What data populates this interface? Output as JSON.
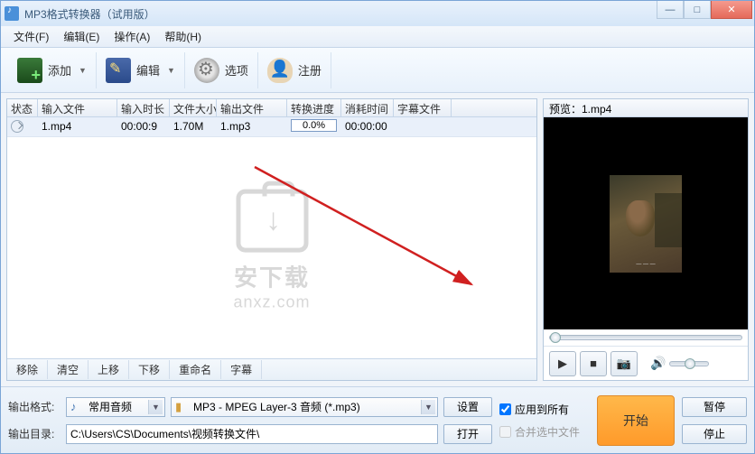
{
  "titlebar": {
    "title": "MP3格式转换器（试用版）"
  },
  "menubar": {
    "file": "文件(F)",
    "edit": "编辑(E)",
    "action": "操作(A)",
    "help": "帮助(H)"
  },
  "toolbar": {
    "add": "添加",
    "edit": "编辑",
    "options": "选项",
    "register": "注册"
  },
  "headers": {
    "status": "状态",
    "input": "输入文件",
    "duration": "输入时长",
    "size": "文件大小",
    "output": "输出文件",
    "progress": "转换进度",
    "elapsed": "消耗时间",
    "subtitle": "字幕文件"
  },
  "rows": [
    {
      "input": "1.mp4",
      "duration": "00:00:9",
      "size": "1.70M",
      "output": "1.mp3",
      "progress": "0.0%",
      "elapsed": "00:00:00",
      "subtitle": ""
    }
  ],
  "watermark": {
    "line1": "安下载",
    "line2": "anxz.com"
  },
  "listActions": {
    "remove": "移除",
    "clear": "清空",
    "moveUp": "上移",
    "moveDown": "下移",
    "rename": "重命名",
    "subtitle": "字幕"
  },
  "preview": {
    "label": "预览：1.mp4"
  },
  "bottom": {
    "formatLabel": "输出格式:",
    "categoryValue": "常用音频",
    "formatValue": "MP3 - MPEG Layer-3 音频 (*.mp3)",
    "settings": "设置",
    "dirLabel": "输出目录:",
    "dirValue": "C:\\Users\\CS\\Documents\\视频转换文件\\",
    "open": "打开",
    "applyAll": "应用到所有",
    "mergeSel": "合并选中文件",
    "start": "开始",
    "pause": "暂停",
    "stop": "停止"
  }
}
